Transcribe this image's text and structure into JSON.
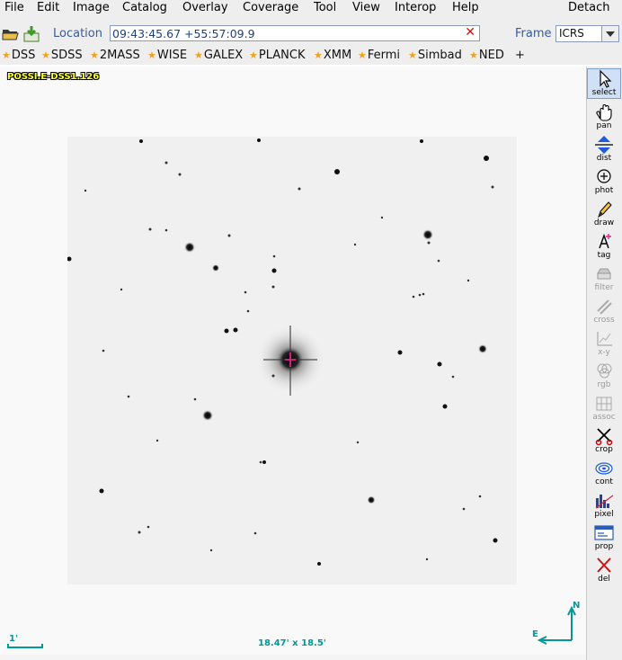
{
  "menubar": {
    "items": [
      "File",
      "Edit",
      "Image",
      "Catalog",
      "Overlay",
      "Coverage",
      "Tool",
      "View",
      "Interop",
      "Help"
    ],
    "detach": "Detach"
  },
  "toolbar": {
    "open_icon": "folder-open-icon",
    "load_icon": "download-icon",
    "location_label": "Location",
    "location_value": "09:43:45.67 +55:57:09.9",
    "clear_icon": "close-icon",
    "frame_label": "Frame",
    "frame_value": "ICRS"
  },
  "surveys": {
    "items": [
      "DSS",
      "SDSS",
      "2MASS",
      "WISE",
      "GALEX",
      "PLANCK",
      "XMM",
      "Fermi",
      "Simbad",
      "NED"
    ],
    "add": "+",
    "star_color": "#f2a21b"
  },
  "view": {
    "image_label": "POSSI.E-DSS1.126",
    "fov": "18.47' x 18.5'",
    "scale_label": "1'",
    "north": "N",
    "east": "E",
    "overlay_color": "#009999"
  },
  "tools": [
    {
      "name": "select",
      "icon": "arrow-pointer-icon",
      "enabled": true,
      "active": true
    },
    {
      "name": "pan",
      "icon": "hand-icon",
      "enabled": true
    },
    {
      "name": "dist",
      "icon": "distance-icon",
      "enabled": true
    },
    {
      "name": "phot",
      "icon": "target-icon",
      "enabled": true
    },
    {
      "name": "draw",
      "icon": "pencil-icon",
      "enabled": true
    },
    {
      "name": "tag",
      "icon": "tag-icon",
      "enabled": true
    },
    {
      "name": "filter",
      "icon": "filter-icon",
      "enabled": false
    },
    {
      "name": "cross",
      "icon": "cross-icon",
      "enabled": false
    },
    {
      "name": "x-y",
      "icon": "xy-plot-icon",
      "enabled": false
    },
    {
      "name": "rgb",
      "icon": "rgb-icon",
      "enabled": false
    },
    {
      "name": "assoc",
      "icon": "assoc-icon",
      "enabled": false
    },
    {
      "name": "crop",
      "icon": "scissors-icon",
      "enabled": true
    },
    {
      "name": "cont",
      "icon": "contour-icon",
      "enabled": true
    },
    {
      "name": "pixel",
      "icon": "histogram-icon",
      "enabled": true
    },
    {
      "name": "prop",
      "icon": "properties-icon",
      "enabled": true
    },
    {
      "name": "del",
      "icon": "delete-icon",
      "enabled": true
    }
  ]
}
